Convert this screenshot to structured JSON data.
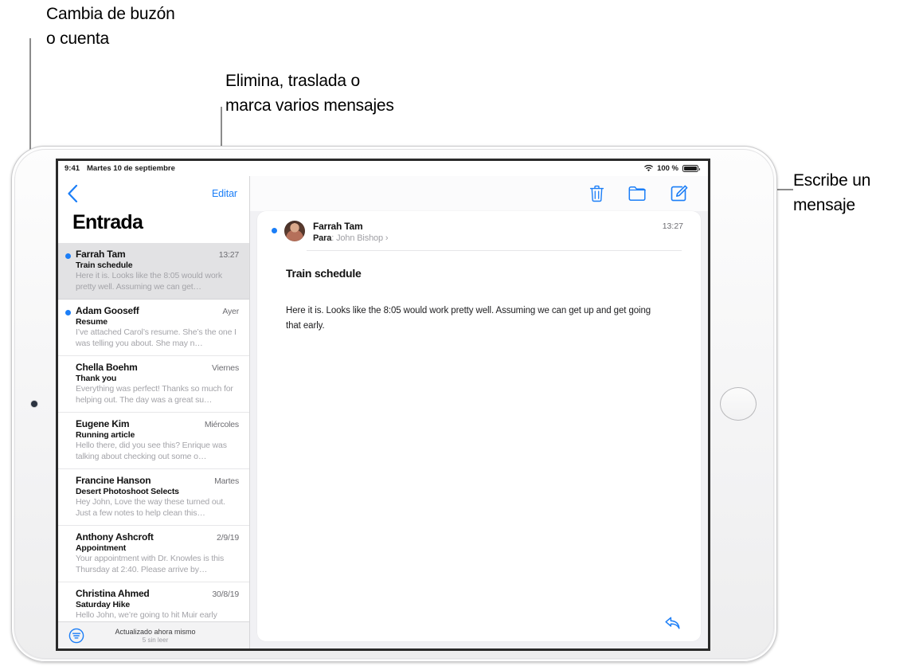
{
  "callouts": [
    {
      "id": "mailbox",
      "text": "Cambia de buzón\no cuenta"
    },
    {
      "id": "edit",
      "text": "Elimina, traslada o\nmarca varios mensajes"
    },
    {
      "id": "compose",
      "text": "Escribe un\nmensaje"
    }
  ],
  "status_bar": {
    "time": "9:41",
    "date": "Martes 10 de septiembre",
    "wifi_icon": "wifi-icon",
    "battery_percent": "100 %",
    "battery_icon": "battery-icon"
  },
  "sidebar": {
    "back_icon": "back-chevron-icon",
    "edit_label": "Editar",
    "title": "Entrada",
    "filter_icon": "filter-icon",
    "footer_status": "Actualizado ahora mismo",
    "footer_unread": "5 sin leer",
    "messages": [
      {
        "from": "Farrah Tam",
        "date": "13:27",
        "subject": "Train schedule",
        "preview": "Here it is. Looks like the 8:05 would work pretty well. Assuming we can get…",
        "unread": true,
        "selected": true
      },
      {
        "from": "Adam Gooseff",
        "date": "Ayer",
        "subject": "Resume",
        "preview": "I’ve attached Carol’s resume. She’s the one I was telling you about. She may n…",
        "unread": true,
        "selected": false
      },
      {
        "from": "Chella Boehm",
        "date": "Viernes",
        "subject": "Thank you",
        "preview": "Everything was perfect! Thanks so much for helping out. The day was a great su…",
        "unread": false,
        "selected": false
      },
      {
        "from": "Eugene Kim",
        "date": "Miércoles",
        "subject": "Running article",
        "preview": "Hello there, did you see this? Enrique was talking about checking out some o…",
        "unread": false,
        "selected": false
      },
      {
        "from": "Francine Hanson",
        "date": "Martes",
        "subject": "Desert Photoshoot Selects",
        "preview": "Hey John, Love the way these turned out. Just a few notes to help clean this…",
        "unread": false,
        "selected": false
      },
      {
        "from": "Anthony Ashcroft",
        "date": "2/9/19",
        "subject": "Appointment",
        "preview": "Your appointment with Dr. Knowles is this Thursday at 2:40. Please arrive by…",
        "unread": false,
        "selected": false
      },
      {
        "from": "Christina Ahmed",
        "date": "30/8/19",
        "subject": "Saturday Hike",
        "preview": "Hello John, we’re going to hit Muir early",
        "unread": false,
        "selected": false
      }
    ]
  },
  "detail": {
    "toolbar": {
      "trash_icon": "trash-icon",
      "folder_icon": "folder-icon",
      "compose_icon": "compose-icon"
    },
    "message": {
      "sender": "Farrah Tam",
      "to_label": "Para",
      "to_name": "John Bishop",
      "to_chevron": "›",
      "time": "13:27",
      "subject": "Train schedule",
      "body": "Here it is. Looks like the 8:05 would work pretty well. Assuming we can get up and get going that early.",
      "avatar": "contact-avatar",
      "reply_icon": "reply-icon"
    }
  },
  "colors": {
    "accent_blue": "#1b7ef7",
    "selected_row": "#e2e2e4",
    "detail_bg": "#f1f1f4"
  }
}
